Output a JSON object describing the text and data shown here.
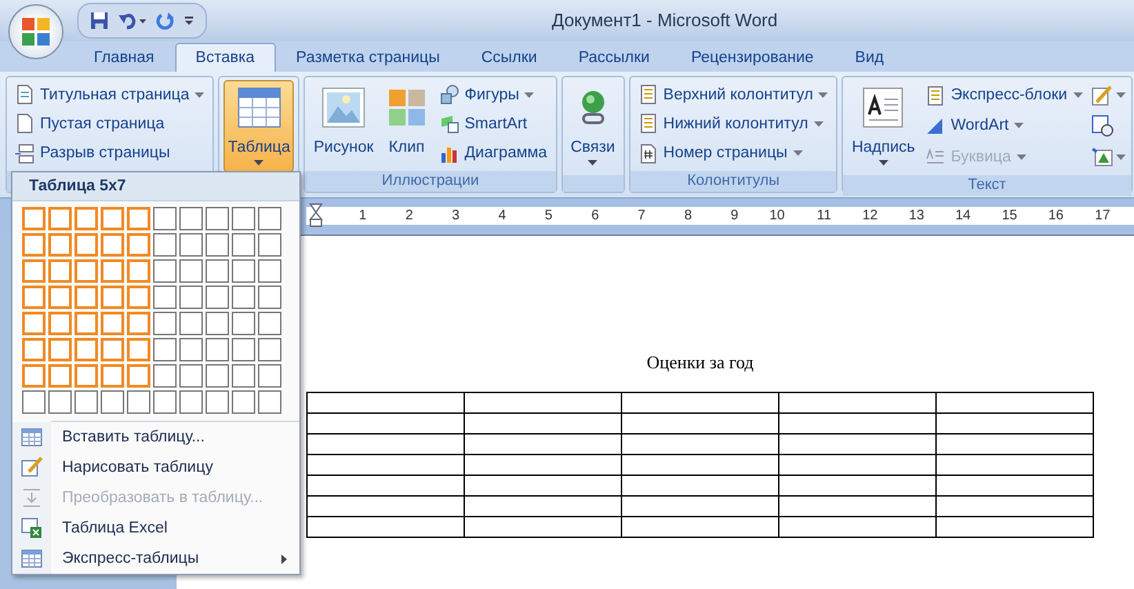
{
  "window": {
    "title": "Документ1 - Microsoft Word"
  },
  "tabs": [
    {
      "label": "Главная",
      "selected": false
    },
    {
      "label": "Вставка",
      "selected": true
    },
    {
      "label": "Разметка страницы",
      "selected": false
    },
    {
      "label": "Ссылки",
      "selected": false
    },
    {
      "label": "Рассылки",
      "selected": false
    },
    {
      "label": "Рецензирование",
      "selected": false
    },
    {
      "label": "Вид",
      "selected": false
    }
  ],
  "ribbon": {
    "groups": [
      {
        "kind": "list",
        "items": [
          {
            "label": "Титульная страница",
            "dropdown": true,
            "disabled": false
          },
          {
            "label": "Пустая страница",
            "dropdown": false,
            "disabled": false
          },
          {
            "label": "Разрыв страницы",
            "dropdown": false,
            "disabled": false
          }
        ]
      },
      {
        "kind": "big",
        "buttons": [
          {
            "label": "Таблица",
            "pressed": true,
            "dropdown": true
          }
        ]
      },
      {
        "kind": "mixed",
        "label": "Иллюстрации",
        "buttons": [
          {
            "label": "Рисунок",
            "pressed": false,
            "dropdown": false
          },
          {
            "label": "Клип",
            "pressed": false,
            "dropdown": false
          }
        ],
        "items": [
          {
            "label": "Фигуры",
            "dropdown": true,
            "disabled": false
          },
          {
            "label": "SmartArt",
            "dropdown": false,
            "disabled": false
          },
          {
            "label": "Диаграмма",
            "dropdown": false,
            "disabled": false
          }
        ]
      },
      {
        "kind": "big",
        "buttons": [
          {
            "label": "Связи",
            "pressed": false,
            "dropdown": true
          }
        ]
      },
      {
        "kind": "list",
        "label": "Колонтитулы",
        "items": [
          {
            "label": "Верхний колонтитул",
            "dropdown": true,
            "disabled": false
          },
          {
            "label": "Нижний колонтитул",
            "dropdown": true,
            "disabled": false
          },
          {
            "label": "Номер страницы",
            "dropdown": true,
            "disabled": false
          }
        ]
      },
      {
        "kind": "mixed",
        "label": "Текст",
        "buttons": [
          {
            "label": "Надпись",
            "pressed": false,
            "dropdown": true
          }
        ],
        "items": [
          {
            "label": "Экспресс-блоки",
            "dropdown": true,
            "disabled": false
          },
          {
            "label": "WordArt",
            "dropdown": true,
            "disabled": false
          },
          {
            "label": "Буквица",
            "dropdown": true,
            "disabled": true
          }
        ],
        "tools": [
          {
            "dropdown": true
          },
          {
            "dropdown": false
          },
          {
            "dropdown": true
          }
        ]
      }
    ]
  },
  "ruler": {
    "numbers": [
      "1",
      "2",
      "3",
      "4",
      "5",
      "6",
      "7",
      "8",
      "9",
      "10",
      "11",
      "12",
      "13",
      "14",
      "15",
      "16",
      "17"
    ]
  },
  "document": {
    "heading": "Оценки за год"
  },
  "table_menu": {
    "title": "Таблица 5x7",
    "grid": [
      {
        "cells": [
          {
            "selected": true
          },
          {
            "selected": true
          },
          {
            "selected": true
          },
          {
            "selected": true
          },
          {
            "selected": true
          },
          {
            "selected": false
          },
          {
            "selected": false
          },
          {
            "selected": false
          },
          {
            "selected": false
          },
          {
            "selected": false
          }
        ]
      },
      {
        "cells": [
          {
            "selected": true
          },
          {
            "selected": true
          },
          {
            "selected": true
          },
          {
            "selected": true
          },
          {
            "selected": true
          },
          {
            "selected": false
          },
          {
            "selected": false
          },
          {
            "selected": false
          },
          {
            "selected": false
          },
          {
            "selected": false
          }
        ]
      },
      {
        "cells": [
          {
            "selected": true
          },
          {
            "selected": true
          },
          {
            "selected": true
          },
          {
            "selected": true
          },
          {
            "selected": true
          },
          {
            "selected": false
          },
          {
            "selected": false
          },
          {
            "selected": false
          },
          {
            "selected": false
          },
          {
            "selected": false
          }
        ]
      },
      {
        "cells": [
          {
            "selected": true
          },
          {
            "selected": true
          },
          {
            "selected": true
          },
          {
            "selected": true
          },
          {
            "selected": true
          },
          {
            "selected": false
          },
          {
            "selected": false
          },
          {
            "selected": false
          },
          {
            "selected": false
          },
          {
            "selected": false
          }
        ]
      },
      {
        "cells": [
          {
            "selected": true
          },
          {
            "selected": true
          },
          {
            "selected": true
          },
          {
            "selected": true
          },
          {
            "selected": true
          },
          {
            "selected": false
          },
          {
            "selected": false
          },
          {
            "selected": false
          },
          {
            "selected": false
          },
          {
            "selected": false
          }
        ]
      },
      {
        "cells": [
          {
            "selected": true
          },
          {
            "selected": true
          },
          {
            "selected": true
          },
          {
            "selected": true
          },
          {
            "selected": true
          },
          {
            "selected": false
          },
          {
            "selected": false
          },
          {
            "selected": false
          },
          {
            "selected": false
          },
          {
            "selected": false
          }
        ]
      },
      {
        "cells": [
          {
            "selected": true
          },
          {
            "selected": true
          },
          {
            "selected": true
          },
          {
            "selected": true
          },
          {
            "selected": true
          },
          {
            "selected": false
          },
          {
            "selected": false
          },
          {
            "selected": false
          },
          {
            "selected": false
          },
          {
            "selected": false
          }
        ]
      },
      {
        "cells": [
          {
            "selected": false
          },
          {
            "selected": false
          },
          {
            "selected": false
          },
          {
            "selected": false
          },
          {
            "selected": false
          },
          {
            "selected": false
          },
          {
            "selected": false
          },
          {
            "selected": false
          },
          {
            "selected": false
          },
          {
            "selected": false
          }
        ]
      }
    ],
    "items": [
      {
        "label": "Вставить таблицу...",
        "disabled": false,
        "submenu": false
      },
      {
        "label": "Нарисовать таблицу",
        "disabled": false,
        "submenu": false
      },
      {
        "label": "Преобразовать в таблицу...",
        "disabled": true,
        "submenu": false
      },
      {
        "label": "Таблица Excel",
        "disabled": false,
        "submenu": false
      },
      {
        "label": "Экспресс-таблицы",
        "disabled": false,
        "submenu": true
      }
    ]
  }
}
